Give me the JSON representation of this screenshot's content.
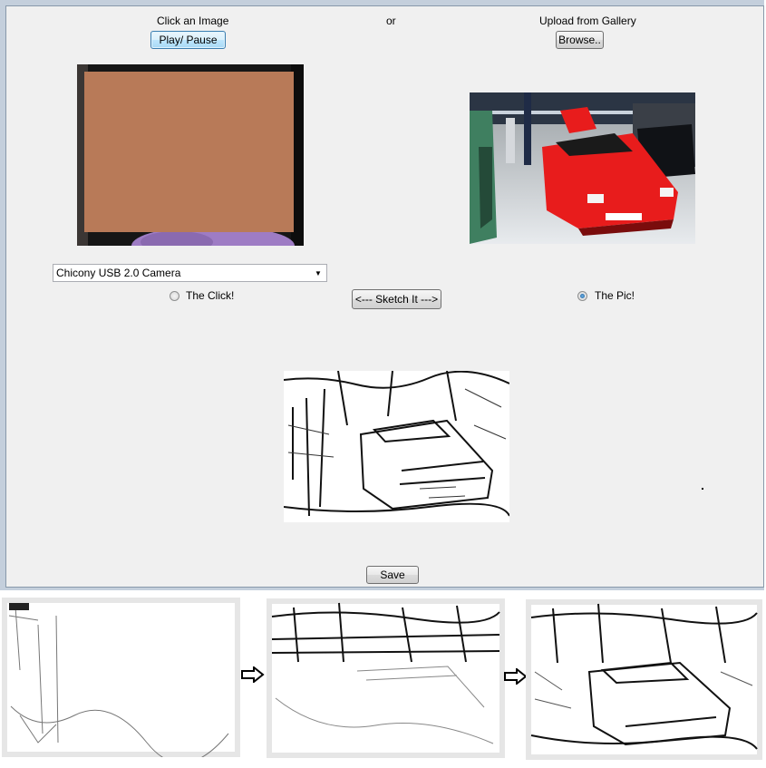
{
  "camera": {
    "caption": "Click an Image",
    "play_pause_label": "Play/ Pause",
    "device_value": "Chicony USB 2.0 Camera"
  },
  "or_label": "or",
  "gallery": {
    "caption": "Upload from Gallery",
    "browse_label": "Browse.."
  },
  "source_options": {
    "click_label": "The Click!",
    "pic_label": "The Pic!",
    "selected": "The Pic!"
  },
  "sketch_button_label": "<---  Sketch It --->",
  "save_label": "Save",
  "colors": {
    "form_background": "#f0f0f0",
    "button_focus_border": "#3c7fb1",
    "webcam_skin": "#b87a58",
    "car_red": "#e81c1c",
    "radio_selected": "#1a5a99"
  },
  "icons": {
    "combo_dropdown": "chevron-down-icon",
    "step_arrow": "right-arrow-icon"
  }
}
